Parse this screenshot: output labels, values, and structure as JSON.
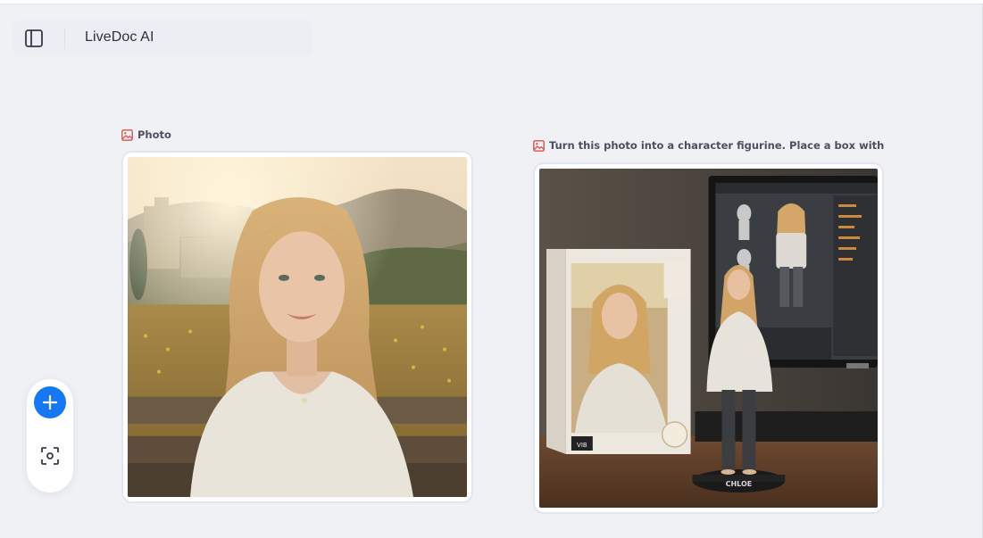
{
  "header": {
    "title": "LiveDoc AI",
    "sidebar_toggle_icon": "sidebar-panel-icon"
  },
  "cards": [
    {
      "label": "Photo",
      "label_icon": "image-icon",
      "image_description_icon": "photo-image"
    },
    {
      "label": "Turn this photo into a character figurine. Place a box with the chara...",
      "label_icon": "image-icon",
      "figurine_base_text": "CHLOE",
      "box_logo_text": "VIB"
    }
  ],
  "float_panel": {
    "add_icon": "plus-icon",
    "scan_icon": "scan-icon"
  },
  "colors": {
    "accent": "#1677f2",
    "label_icon": "#d9534f",
    "background": "#f0f1f5"
  }
}
